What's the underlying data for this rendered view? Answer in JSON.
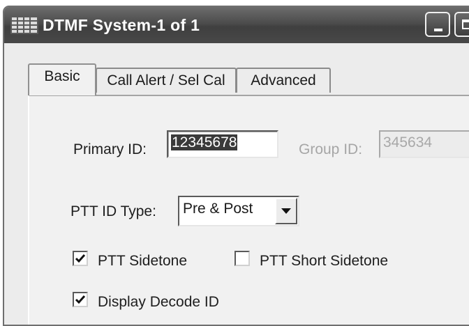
{
  "window": {
    "title": "DTMF System-1 of 1",
    "icon": "keypad-grid-icon"
  },
  "tabs": [
    {
      "label": "Basic",
      "active": true
    },
    {
      "label": "Call Alert / Sel Cal",
      "active": false
    },
    {
      "label": "Advanced",
      "active": false
    }
  ],
  "form": {
    "primary_id": {
      "label": "Primary ID:",
      "value": "12345678",
      "selected": true
    },
    "group_id": {
      "label": "Group ID:",
      "value": "345634",
      "enabled": false
    },
    "ptt_id_type": {
      "label": "PTT ID Type:",
      "value": "Pre & Post"
    },
    "ptt_sidetone": {
      "label": "PTT Sidetone",
      "checked": true
    },
    "ptt_short_sidetone": {
      "label": "PTT Short Sidetone",
      "checked": false
    },
    "display_decode_id": {
      "label": "Display Decode ID",
      "checked": true
    }
  },
  "colors": {
    "titlebar": "#4c4c4c",
    "title_text": "#ffffff",
    "dialog_background": "#ececec",
    "disabled_text": "#a6a6a6",
    "selection": "#3a3a3a"
  }
}
